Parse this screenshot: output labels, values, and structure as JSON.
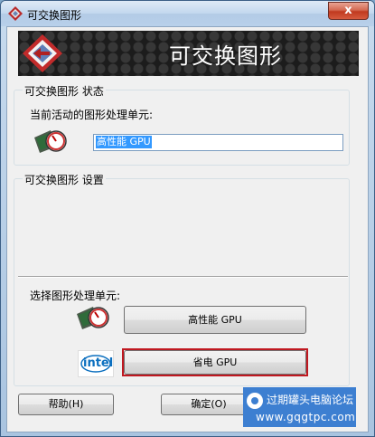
{
  "window": {
    "title": "可交换图形",
    "close_glyph": "x"
  },
  "banner": {
    "title": "可交换图形"
  },
  "status_group": {
    "label": "可交换图形 状态",
    "active_label": "当前活动的图形处理单元:",
    "active_value": "高性能 GPU"
  },
  "settings_group": {
    "label": "可交换图形 设置"
  },
  "select": {
    "label": "选择图形处理单元:",
    "high_perf_button": "高性能 GPU",
    "power_saving_button": "省电 GPU",
    "intel_logo": "intel"
  },
  "footer": {
    "help_button": "帮助(H)",
    "ok_button": "确定(O)"
  },
  "watermark": {
    "name": "过期罐头电脑论坛",
    "url": "www.gqgtpc.com"
  },
  "colors": {
    "highlight": "#c01820",
    "selection": "#3399ff",
    "watermark_bg": "#3d7fd1"
  }
}
